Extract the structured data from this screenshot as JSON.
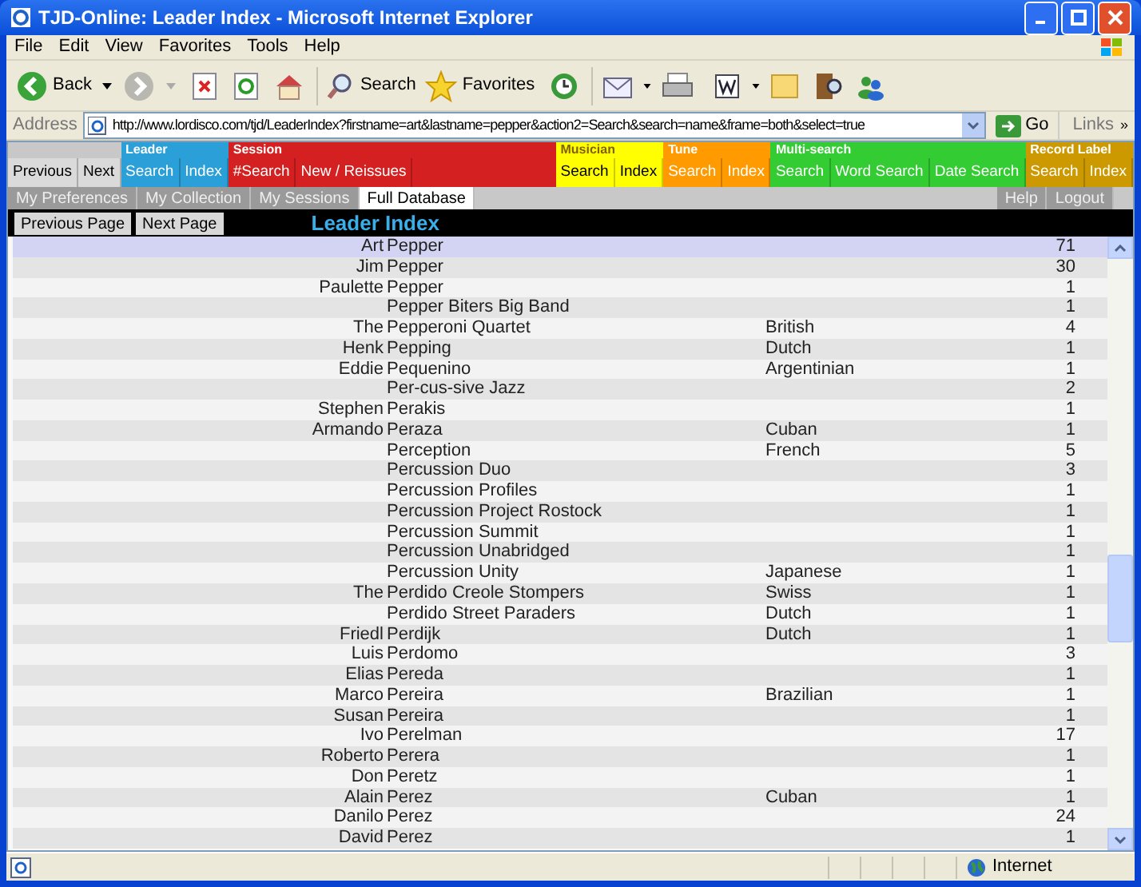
{
  "window": {
    "title": "TJD-Online: Leader Index - Microsoft Internet Explorer"
  },
  "menu": [
    "File",
    "Edit",
    "View",
    "Favorites",
    "Tools",
    "Help"
  ],
  "toolbar": {
    "back": "Back",
    "search": "Search",
    "favorites": "Favorites"
  },
  "address": {
    "label": "Address",
    "url": "http://www.lordisco.com/tjd/LeaderIndex?firstname=art&lastname=pepper&action2=Search&search=name&frame=both&select=true",
    "go": "Go",
    "links": "Links",
    "chevron": "»"
  },
  "nav": {
    "history": [
      "Previous",
      "Next"
    ],
    "groups": [
      {
        "title": "Leader",
        "color": "#2ba0d8",
        "buttons": [
          "Search",
          "Index"
        ]
      },
      {
        "title": "Session",
        "color": "#d42020",
        "buttons": [
          "#Search",
          "New / Reissues"
        ]
      },
      {
        "title": "Musician",
        "color": "#ffff00",
        "buttons": [
          "Search",
          "Index"
        ]
      },
      {
        "title": "Tune",
        "color": "#ff9a00",
        "buttons": [
          "Search",
          "Index"
        ]
      },
      {
        "title": "Multi-search",
        "color": "#33cc33",
        "buttons": [
          "Search",
          "Word Search",
          "Date Search"
        ]
      },
      {
        "title": "Record Label",
        "color": "#cc9900",
        "buttons": [
          "Search",
          "Index"
        ]
      }
    ]
  },
  "tabs": [
    {
      "label": "My Preferences",
      "selected": false
    },
    {
      "label": "My Collection",
      "selected": false
    },
    {
      "label": "My Sessions",
      "selected": false
    },
    {
      "label": "Full Database",
      "selected": true
    }
  ],
  "account_links": [
    "Help",
    "Logout"
  ],
  "pager": [
    "Previous Page",
    "Next Page"
  ],
  "heading": "Leader Index",
  "rows": [
    {
      "first": "Art",
      "last": "Pepper",
      "nationality": "",
      "count": "71",
      "selected": true
    },
    {
      "first": "Jim",
      "last": "Pepper",
      "nationality": "",
      "count": "30",
      "selected": false
    },
    {
      "first": "Paulette",
      "last": "Pepper",
      "nationality": "",
      "count": "1",
      "selected": false
    },
    {
      "first": "",
      "last": "Pepper Biters Big Band",
      "nationality": "",
      "count": "1",
      "selected": false
    },
    {
      "first": "The",
      "last": "Pepperoni Quartet",
      "nationality": "British",
      "count": "4",
      "selected": false
    },
    {
      "first": "Henk",
      "last": "Pepping",
      "nationality": "Dutch",
      "count": "1",
      "selected": false
    },
    {
      "first": "Eddie",
      "last": "Pequenino",
      "nationality": "Argentinian",
      "count": "1",
      "selected": false
    },
    {
      "first": "",
      "last": "Per-cus-sive Jazz",
      "nationality": "",
      "count": "2",
      "selected": false
    },
    {
      "first": "Stephen",
      "last": "Perakis",
      "nationality": "",
      "count": "1",
      "selected": false
    },
    {
      "first": "Armando",
      "last": "Peraza",
      "nationality": "Cuban",
      "count": "1",
      "selected": false
    },
    {
      "first": "",
      "last": "Perception",
      "nationality": "French",
      "count": "5",
      "selected": false
    },
    {
      "first": "",
      "last": "Percussion Duo",
      "nationality": "",
      "count": "3",
      "selected": false
    },
    {
      "first": "",
      "last": "Percussion Profiles",
      "nationality": "",
      "count": "1",
      "selected": false
    },
    {
      "first": "",
      "last": "Percussion Project Rostock",
      "nationality": "",
      "count": "1",
      "selected": false
    },
    {
      "first": "",
      "last": "Percussion Summit",
      "nationality": "",
      "count": "1",
      "selected": false
    },
    {
      "first": "",
      "last": "Percussion Unabridged",
      "nationality": "",
      "count": "1",
      "selected": false
    },
    {
      "first": "",
      "last": "Percussion Unity",
      "nationality": "Japanese",
      "count": "1",
      "selected": false
    },
    {
      "first": "The",
      "last": "Perdido Creole Stompers",
      "nationality": "Swiss",
      "count": "1",
      "selected": false
    },
    {
      "first": "",
      "last": "Perdido Street Paraders",
      "nationality": "Dutch",
      "count": "1",
      "selected": false
    },
    {
      "first": "Friedl",
      "last": "Perdijk",
      "nationality": "Dutch",
      "count": "1",
      "selected": false
    },
    {
      "first": "Luis",
      "last": "Perdomo",
      "nationality": "",
      "count": "3",
      "selected": false
    },
    {
      "first": "Elias",
      "last": "Pereda",
      "nationality": "",
      "count": "1",
      "selected": false
    },
    {
      "first": "Marco",
      "last": "Pereira",
      "nationality": "Brazilian",
      "count": "1",
      "selected": false
    },
    {
      "first": "Susan",
      "last": "Pereira",
      "nationality": "",
      "count": "1",
      "selected": false
    },
    {
      "first": "Ivo",
      "last": "Perelman",
      "nationality": "",
      "count": "17",
      "selected": false
    },
    {
      "first": "Roberto",
      "last": "Perera",
      "nationality": "",
      "count": "1",
      "selected": false
    },
    {
      "first": "Don",
      "last": "Peretz",
      "nationality": "",
      "count": "1",
      "selected": false
    },
    {
      "first": "Alain",
      "last": "Perez",
      "nationality": "Cuban",
      "count": "1",
      "selected": false
    },
    {
      "first": "Danilo",
      "last": "Perez",
      "nationality": "",
      "count": "24",
      "selected": false
    },
    {
      "first": "David",
      "last": "Perez",
      "nationality": "",
      "count": "1",
      "selected": false
    }
  ],
  "status_bar": {
    "zone": "Internet"
  }
}
